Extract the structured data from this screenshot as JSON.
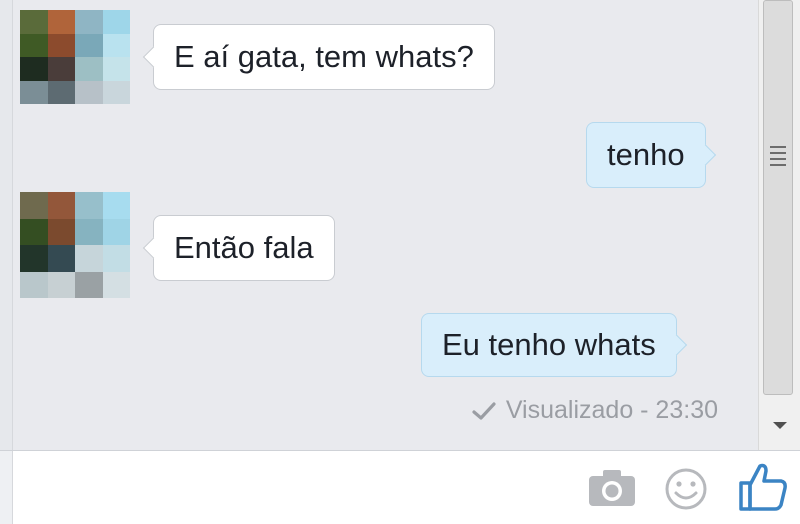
{
  "chat": {
    "messages": [
      {
        "direction": "incoming",
        "text": "E aí gata, tem whats?"
      },
      {
        "direction": "outgoing",
        "text": "tenho"
      },
      {
        "direction": "incoming",
        "text": "Então fala"
      },
      {
        "direction": "outgoing",
        "text": "Eu tenho whats"
      }
    ],
    "seen_status": "Visualizado - 23:30"
  },
  "composer": {
    "icons": [
      "camera-icon",
      "emoji-icon",
      "like-icon"
    ]
  },
  "colors": {
    "incoming_bubble": "#ffffff",
    "outgoing_bubble": "#d9eefb",
    "like_blue": "#3b84c4",
    "background": "#e9eaee"
  }
}
